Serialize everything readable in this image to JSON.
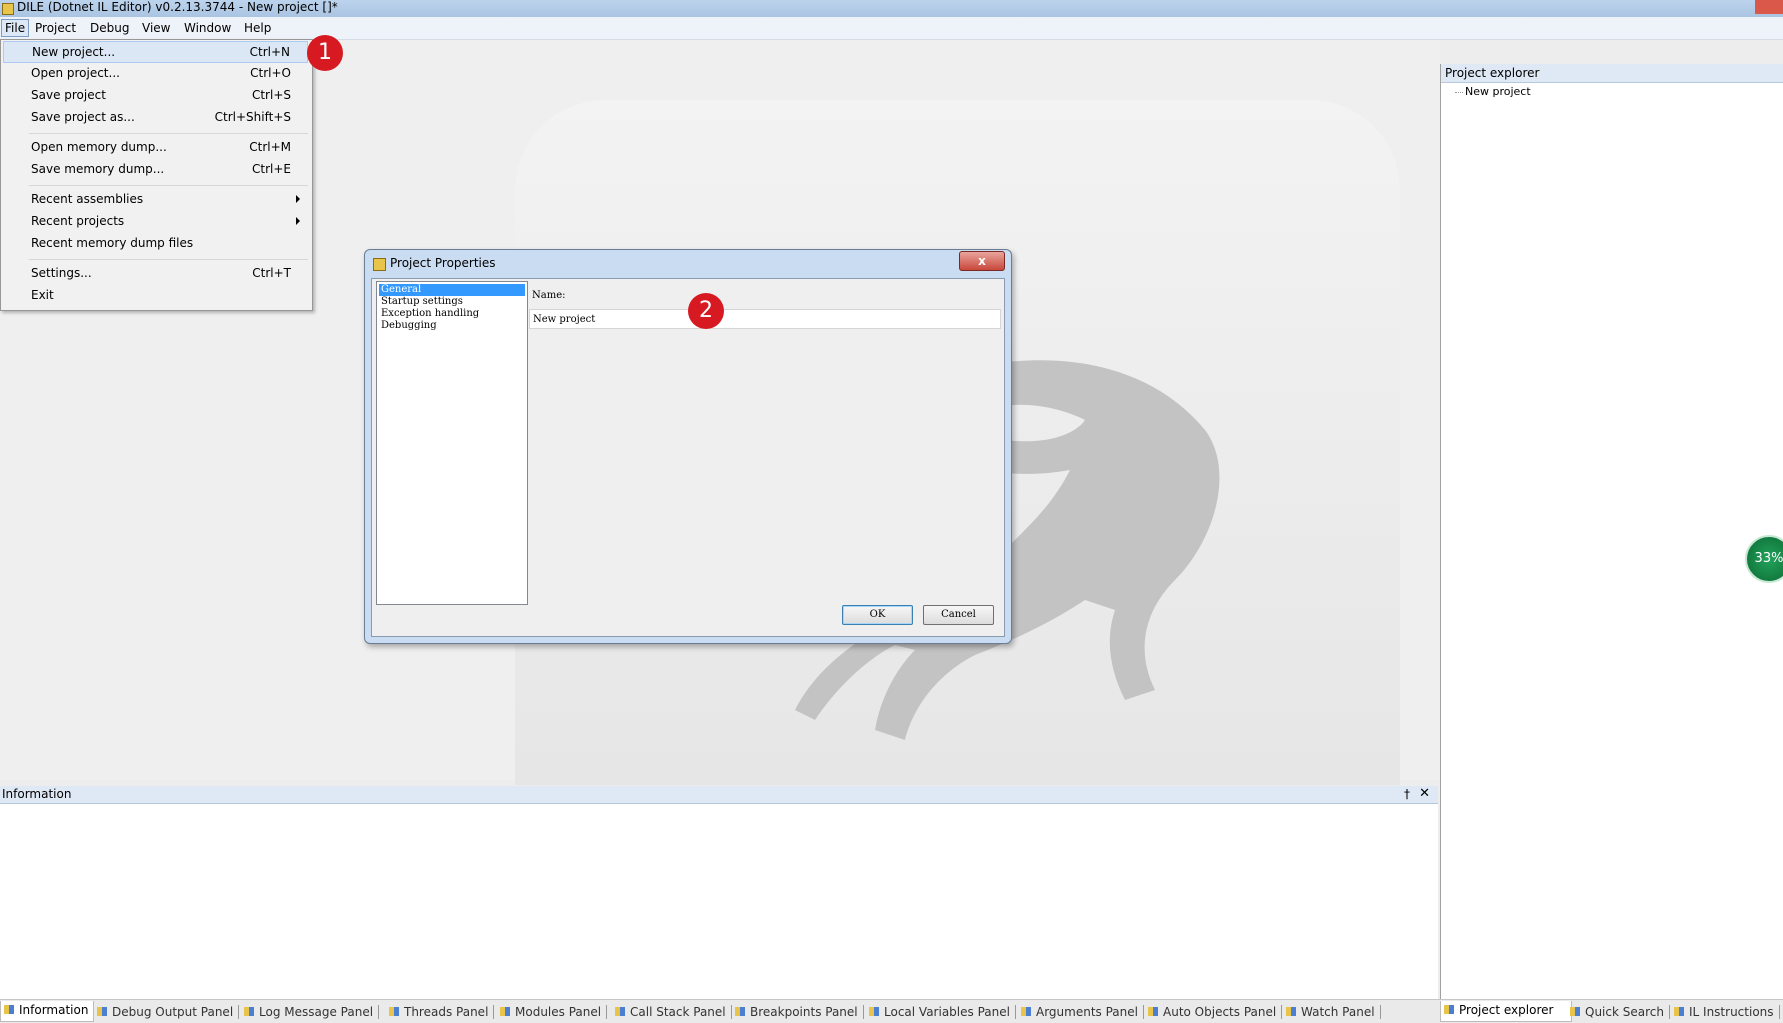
{
  "window": {
    "title": "DILE (Dotnet IL Editor) v0.2.13.3744 - New project []*"
  },
  "menubar": {
    "items": [
      "File",
      "Project",
      "Debug",
      "View",
      "Window",
      "Help"
    ]
  },
  "file_menu": {
    "items": [
      {
        "label": "New project...",
        "shortcut": "Ctrl+N"
      },
      {
        "label": "Open project...",
        "shortcut": "Ctrl+O"
      },
      {
        "label": "Save project",
        "shortcut": "Ctrl+S"
      },
      {
        "label": "Save project as...",
        "shortcut": "Ctrl+Shift+S"
      },
      {
        "label": "Open memory dump...",
        "shortcut": "Ctrl+M"
      },
      {
        "label": "Save memory dump...",
        "shortcut": "Ctrl+E"
      },
      {
        "label": "Recent assemblies",
        "shortcut": ""
      },
      {
        "label": "Recent projects",
        "shortcut": ""
      },
      {
        "label": "Recent memory dump files",
        "shortcut": ""
      },
      {
        "label": "Settings...",
        "shortcut": "Ctrl+T"
      },
      {
        "label": "Exit",
        "shortcut": ""
      }
    ]
  },
  "callouts": [
    "1",
    "2"
  ],
  "dialog": {
    "title": "Project Properties",
    "close_label": "x",
    "nav": [
      "General",
      "Startup settings",
      "Exception handling",
      "Debugging"
    ],
    "name_label": "Name:",
    "name_value": "New project",
    "ok": "OK",
    "cancel": "Cancel"
  },
  "project_explorer": {
    "title": "Project explorer",
    "node": "New project"
  },
  "info_panel": {
    "title": "Information",
    "pin": "†",
    "close": "✕"
  },
  "bottom_tabs": [
    "Information",
    "Debug Output Panel",
    "Log Message Panel",
    "Threads Panel",
    "Modules Panel",
    "Call Stack Panel",
    "Breakpoints Panel",
    "Local Variables Panel",
    "Arguments Panel",
    "Auto Objects Panel",
    "Watch Panel"
  ],
  "right_tabs": [
    "Project explorer",
    "Quick Search",
    "IL Instructions"
  ],
  "progress_badge": "33%"
}
